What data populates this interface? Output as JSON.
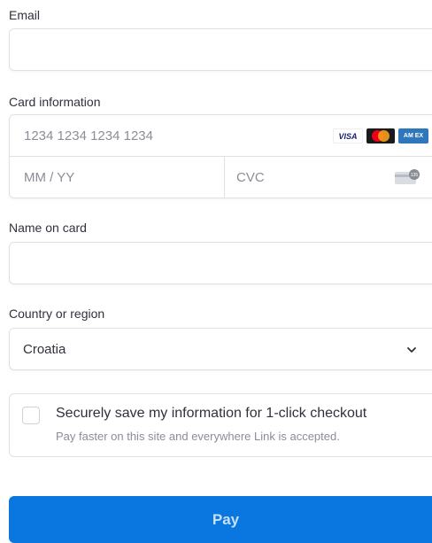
{
  "email": {
    "label": "Email",
    "value": ""
  },
  "card": {
    "label": "Card information",
    "number_placeholder": "1234 1234 1234 1234",
    "expiry_placeholder": "MM / YY",
    "cvc_placeholder": "CVC",
    "brands": [
      "VISA",
      "mastercard",
      "AMEX"
    ],
    "amex_text": "AM EX",
    "cvc_badge": "135"
  },
  "name": {
    "label": "Name on card",
    "value": ""
  },
  "country": {
    "label": "Country or region",
    "value": "Croatia"
  },
  "save": {
    "title": "Securely save my information for 1-click checkout",
    "subtitle": "Pay faster on this site and everywhere Link is accepted."
  },
  "pay_button": {
    "label": "Pay",
    "color": "#0a76e0"
  }
}
